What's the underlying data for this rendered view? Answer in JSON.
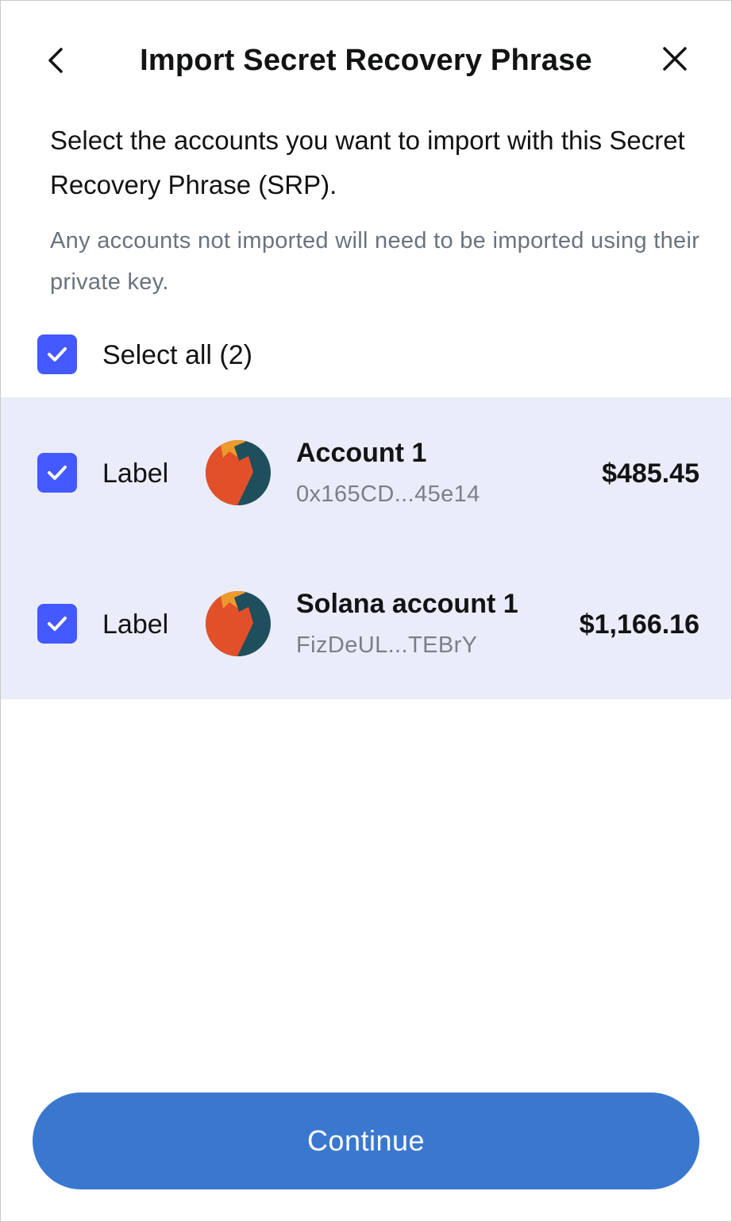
{
  "header": {
    "title": "Import Secret Recovery Phrase",
    "back_icon": "chevron-left-icon",
    "close_icon": "close-icon"
  },
  "intro": {
    "text": "Select the accounts you want to import with this Secret Recovery Phrase (SRP).",
    "note": "Any accounts not imported will need to be imported using their private key."
  },
  "select_all": {
    "label": "Select all (2)",
    "checked": true
  },
  "accounts": [
    {
      "checked": true,
      "label": "Label",
      "name": "Account 1",
      "address": "0x165CD...45e14",
      "balance": "$485.45",
      "avatar_icon": "jazzicon-avatar"
    },
    {
      "checked": true,
      "label": "Label",
      "name": "Solana account 1",
      "address": "FizDeUL...TEBrY",
      "balance": "$1,166.16",
      "avatar_icon": "jazzicon-avatar"
    }
  ],
  "footer": {
    "continue_label": "Continue"
  },
  "colors": {
    "accent": "#4459ff",
    "panel_bg": "#eaecfa",
    "button_bg": "#3a78d0",
    "muted_text": "#6a737d"
  }
}
